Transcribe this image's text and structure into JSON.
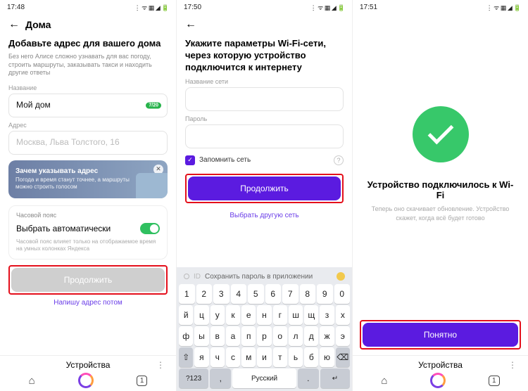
{
  "screen1": {
    "time": "17:48",
    "nav_title": "Дома",
    "heading": "Добавьте адрес для вашего дома",
    "subtitle": "Без него Алисе сложно узнавать для вас погоду, строить маршруты, заказывать такси и находить другие ответы",
    "name_label": "Название",
    "name_value": "Мой дом",
    "name_counter": "7/20",
    "addr_label": "Адрес",
    "addr_placeholder": "Москва, Льва Толстого, 16",
    "promo_title": "Зачем указывать адрес",
    "promo_text": "Погода и время станут точнее, а маршруты можно строить голосом",
    "tz_label": "Часовой пояс",
    "tz_value": "Выбрать автоматически",
    "tz_note": "Часовой пояс влияет только на отображаемое время на умных колонках Яндекса",
    "continue_label": "Продолжить",
    "later_label": "Напишу адрес потом",
    "tab_title": "Устройства"
  },
  "screen2": {
    "time": "17:50",
    "heading": "Укажите параметры Wi-Fi-сети, через которую устройство подключится к интернету",
    "net_label": "Название сети",
    "pw_label": "Пароль",
    "remember_label": "Запомнить сеть",
    "continue_label": "Продолжить",
    "other_net_label": "Выбрать другую сеть",
    "kb_hint": "Сохранить пароль в приложении",
    "kb_id": "ID",
    "row1": [
      "1",
      "2",
      "3",
      "4",
      "5",
      "6",
      "7",
      "8",
      "9",
      "0"
    ],
    "row2": [
      "й",
      "ц",
      "у",
      "к",
      "е",
      "н",
      "г",
      "ш",
      "щ",
      "з",
      "х"
    ],
    "row3": [
      "ф",
      "ы",
      "в",
      "а",
      "п",
      "р",
      "о",
      "л",
      "д",
      "ж",
      "э"
    ],
    "row4": [
      "я",
      "ч",
      "с",
      "м",
      "и",
      "т",
      "ь",
      "б",
      "ю"
    ],
    "row5_mode": "?123",
    "row5_lang": "Русский"
  },
  "screen3": {
    "time": "17:51",
    "title": "Устройство подключилось к Wi-Fi",
    "subtitle": "Теперь оно скачивает обновление. Устройство скажет, когда всё будет готово",
    "ok_label": "Понятно",
    "tab_title": "Устройства"
  }
}
